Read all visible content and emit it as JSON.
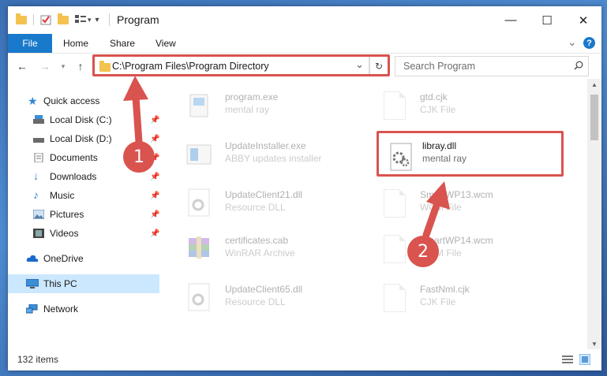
{
  "window": {
    "title": "Program",
    "controls": {
      "minimize": "—",
      "maximize": "☐",
      "close": "✕"
    }
  },
  "ribbon": {
    "file": "File",
    "tabs": [
      "Home",
      "Share",
      "View"
    ],
    "expand": "⌄",
    "help": "?"
  },
  "address": {
    "back": "←",
    "forward": "→",
    "up": "↑",
    "path": "C:\\Program Files\\Program Directory",
    "dropdown": "⌄",
    "refresh": "↻"
  },
  "search": {
    "placeholder": "Search Program"
  },
  "nav": {
    "items": [
      {
        "label": "Quick access"
      },
      {
        "label": "Local Disk (C:)"
      },
      {
        "label": "Local Disk (D:)"
      },
      {
        "label": "Documents"
      },
      {
        "label": "Downloads"
      },
      {
        "label": "Music"
      },
      {
        "label": "Pictures"
      },
      {
        "label": "Videos"
      },
      {
        "label": "OneDrive"
      },
      {
        "label": "This PC"
      },
      {
        "label": "Network"
      }
    ]
  },
  "files": [
    {
      "name": "program.exe",
      "type": "mental ray"
    },
    {
      "name": "gtd.cjk",
      "type": "CJK File"
    },
    {
      "name": "UpdateInstaller.exe",
      "type": "ABBY updates installer"
    },
    {
      "name": "libray.dll",
      "type": "mental ray"
    },
    {
      "name": "UpdateClient21.dll",
      "type": "Resource DLL"
    },
    {
      "name": "SmartWP13.wcm",
      "type": "WCM File"
    },
    {
      "name": "certificates.cab",
      "type": "WinRAR Archive"
    },
    {
      "name": "SmartWP14.wcm",
      "type": "WCM File"
    },
    {
      "name": "UpdateClient65.dll",
      "type": "Resource DLL"
    },
    {
      "name": "FastNml.cjk",
      "type": "CJK File"
    }
  ],
  "status": {
    "count": "132 items"
  },
  "annotations": {
    "step1": "1",
    "step2": "2"
  },
  "colors": {
    "accent": "#1979ca",
    "annotation": "#d9534f",
    "selection": "#cce8ff"
  }
}
